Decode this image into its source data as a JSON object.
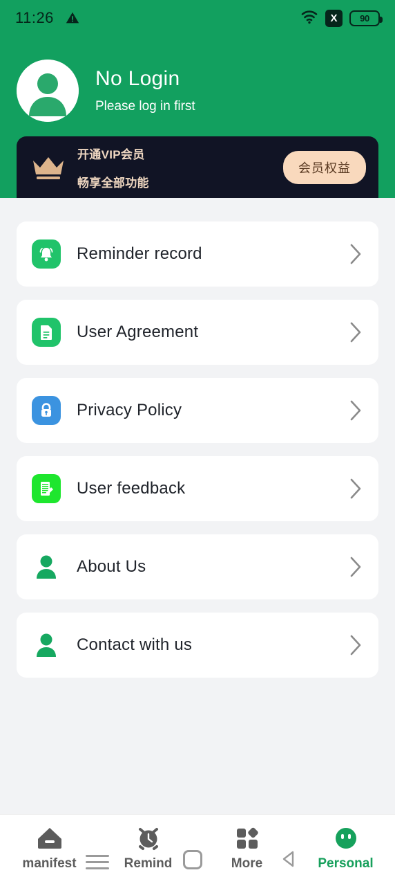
{
  "status_bar": {
    "time": "11:26",
    "warning_icon": "warning-triangle-icon",
    "wifi_icon": "wifi-icon",
    "no_signal_icon": "x-icon",
    "no_signal_label": "X",
    "battery_level": "90"
  },
  "header": {
    "background_color": "#12a05f",
    "avatar_icon": "user-avatar-icon",
    "title": "No Login",
    "subtitle": "Please log in first"
  },
  "vip_banner": {
    "background_color": "#111425",
    "crown_icon": "crown-icon",
    "title": "开通VIP会员",
    "subtitle": "畅享全部功能",
    "button_label": "会员权益",
    "button_color": "#f9d9bd"
  },
  "menu": {
    "items": [
      {
        "label": "Reminder record",
        "icon": "bell-icon",
        "icon_style": "green",
        "chevron": "chevron-right-icon"
      },
      {
        "label": "User Agreement",
        "icon": "document-icon",
        "icon_style": "green",
        "chevron": "chevron-right-icon"
      },
      {
        "label": "Privacy Policy",
        "icon": "lock-icon",
        "icon_style": "blue",
        "chevron": "chevron-right-icon"
      },
      {
        "label": "User feedback",
        "icon": "feedback-edit-icon",
        "icon_style": "neon",
        "chevron": "chevron-right-icon"
      },
      {
        "label": "About Us",
        "icon": "person-icon",
        "icon_style": "plain",
        "chevron": "chevron-right-icon"
      },
      {
        "label": "Contact with us",
        "icon": "person-icon",
        "icon_style": "plain",
        "chevron": "chevron-right-icon"
      }
    ]
  },
  "bottom_nav": {
    "active_color": "#17a05c",
    "items": [
      {
        "label": "manifest",
        "icon": "home-icon",
        "active": false
      },
      {
        "label": "Remind",
        "icon": "alarm-clock-icon",
        "active": false
      },
      {
        "label": "More",
        "icon": "grid-apps-icon",
        "active": false
      },
      {
        "label": "Personal",
        "icon": "face-circle-icon",
        "active": true
      }
    ]
  },
  "system_gestures": {
    "menu_icon": "hamburger-menu-icon",
    "recents_icon": "square-recents-icon",
    "back_icon": "back-triangle-icon"
  }
}
